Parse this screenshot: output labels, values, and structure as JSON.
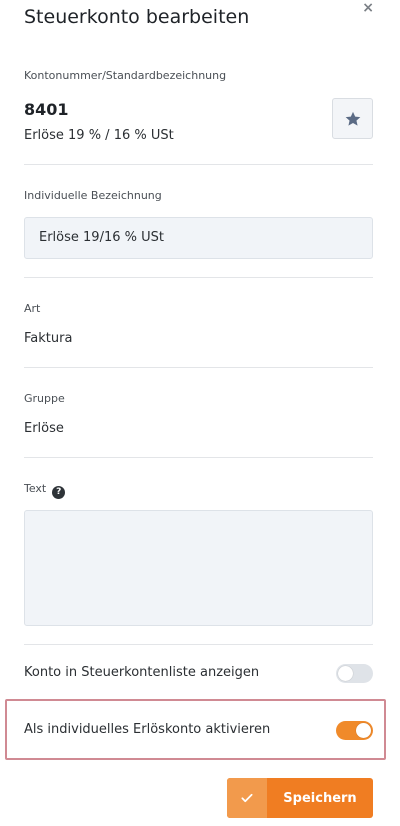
{
  "header": {
    "title": "Steuerkonto bearbeiten",
    "close_glyph": "×"
  },
  "account": {
    "label": "Kontonummer/Standardbezeichnung",
    "number": "8401",
    "standard_name": "Erlöse 19 % / 16 % USt",
    "favorite_icon": "star-icon"
  },
  "individual_name": {
    "label": "Individuelle Bezeichnung",
    "value": "Erlöse 19/16 % USt"
  },
  "type": {
    "label": "Art",
    "value": "Faktura"
  },
  "group": {
    "label": "Gruppe",
    "value": "Erlöse"
  },
  "text": {
    "label": "Text",
    "help_glyph": "?",
    "value": ""
  },
  "toggles": {
    "show_in_list": {
      "label": "Konto in Steuerkontenliste anzeigen",
      "checked": false
    },
    "individual_revenue": {
      "label": "Als individuelles Erlöskonto aktivieren",
      "checked": true
    }
  },
  "actions": {
    "save_label": "Speichern",
    "save_icon": "check-icon"
  },
  "colors": {
    "accent": "#f07d22",
    "accent_light": "#f29a4c",
    "highlight": "#d08a93",
    "star": "#5b6b85"
  }
}
